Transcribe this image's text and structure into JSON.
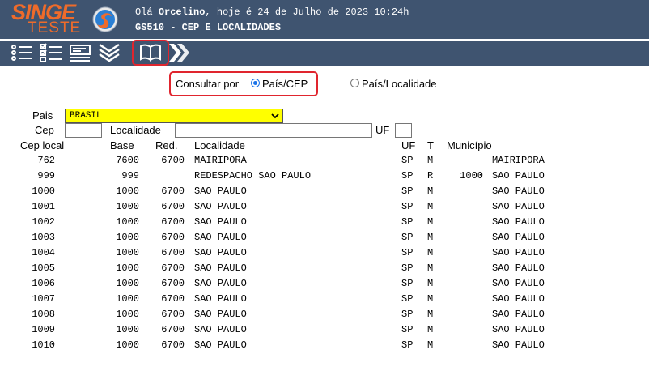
{
  "header": {
    "brand_top": "SINGE",
    "brand_bottom": "TESTE",
    "greeting_prefix": "Olá ",
    "user": "Orcelino",
    "greeting_suffix": ", hoje é 24 de Julho de 2023 10:24h",
    "program": "GS510 - CEP E LOCALIDADES"
  },
  "toolbar": {
    "icons": [
      "list-icon",
      "checklist-icon",
      "form-icon",
      "collapse-icon",
      "book-icon",
      "forward-icon"
    ],
    "highlighted": "book-icon"
  },
  "query": {
    "label": "Consultar por",
    "options": [
      {
        "label": "País/CEP",
        "selected": true
      },
      {
        "label": "País/Localidade",
        "selected": false
      }
    ]
  },
  "form": {
    "pais_label": "Pais",
    "pais_value": "BRASIL",
    "cep_label": "Cep",
    "cep_value": "",
    "localidade_label": "Localidade",
    "localidade_value": "",
    "uf_label": "UF",
    "uf_value": ""
  },
  "table": {
    "headers": [
      "Cep local",
      "Base",
      "Red.",
      "Localidade",
      "UF",
      "T",
      "Município"
    ],
    "rows": [
      {
        "cep": "762",
        "base": "7600",
        "red": "6700",
        "localidade": "MAIRIPORA",
        "uf": "SP",
        "t": "M",
        "mun_code": "",
        "municipio": "MAIRIPORA"
      },
      {
        "cep": "999",
        "base": "999",
        "red": "",
        "localidade": "REDESPACHO SAO PAULO",
        "uf": "SP",
        "t": "R",
        "mun_code": "1000",
        "municipio": "SAO PAULO"
      },
      {
        "cep": "1000",
        "base": "1000",
        "red": "6700",
        "localidade": "SAO PAULO",
        "uf": "SP",
        "t": "M",
        "mun_code": "",
        "municipio": "SAO PAULO"
      },
      {
        "cep": "1001",
        "base": "1000",
        "red": "6700",
        "localidade": "SAO PAULO",
        "uf": "SP",
        "t": "M",
        "mun_code": "",
        "municipio": "SAO PAULO"
      },
      {
        "cep": "1002",
        "base": "1000",
        "red": "6700",
        "localidade": "SAO PAULO",
        "uf": "SP",
        "t": "M",
        "mun_code": "",
        "municipio": "SAO PAULO"
      },
      {
        "cep": "1003",
        "base": "1000",
        "red": "6700",
        "localidade": "SAO PAULO",
        "uf": "SP",
        "t": "M",
        "mun_code": "",
        "municipio": "SAO PAULO"
      },
      {
        "cep": "1004",
        "base": "1000",
        "red": "6700",
        "localidade": "SAO PAULO",
        "uf": "SP",
        "t": "M",
        "mun_code": "",
        "municipio": "SAO PAULO"
      },
      {
        "cep": "1005",
        "base": "1000",
        "red": "6700",
        "localidade": "SAO PAULO",
        "uf": "SP",
        "t": "M",
        "mun_code": "",
        "municipio": "SAO PAULO"
      },
      {
        "cep": "1006",
        "base": "1000",
        "red": "6700",
        "localidade": "SAO PAULO",
        "uf": "SP",
        "t": "M",
        "mun_code": "",
        "municipio": "SAO PAULO"
      },
      {
        "cep": "1007",
        "base": "1000",
        "red": "6700",
        "localidade": "SAO PAULO",
        "uf": "SP",
        "t": "M",
        "mun_code": "",
        "municipio": "SAO PAULO"
      },
      {
        "cep": "1008",
        "base": "1000",
        "red": "6700",
        "localidade": "SAO PAULO",
        "uf": "SP",
        "t": "M",
        "mun_code": "",
        "municipio": "SAO PAULO"
      },
      {
        "cep": "1009",
        "base": "1000",
        "red": "6700",
        "localidade": "SAO PAULO",
        "uf": "SP",
        "t": "M",
        "mun_code": "",
        "municipio": "SAO PAULO"
      },
      {
        "cep": "1010",
        "base": "1000",
        "red": "6700",
        "localidade": "SAO PAULO",
        "uf": "SP",
        "t": "M",
        "mun_code": "",
        "municipio": "SAO PAULO"
      }
    ]
  },
  "colors": {
    "header_bg": "#3f5470",
    "brand": "#ef6b2a",
    "highlight": "#e0252e",
    "select_bg": "#ffff00"
  }
}
